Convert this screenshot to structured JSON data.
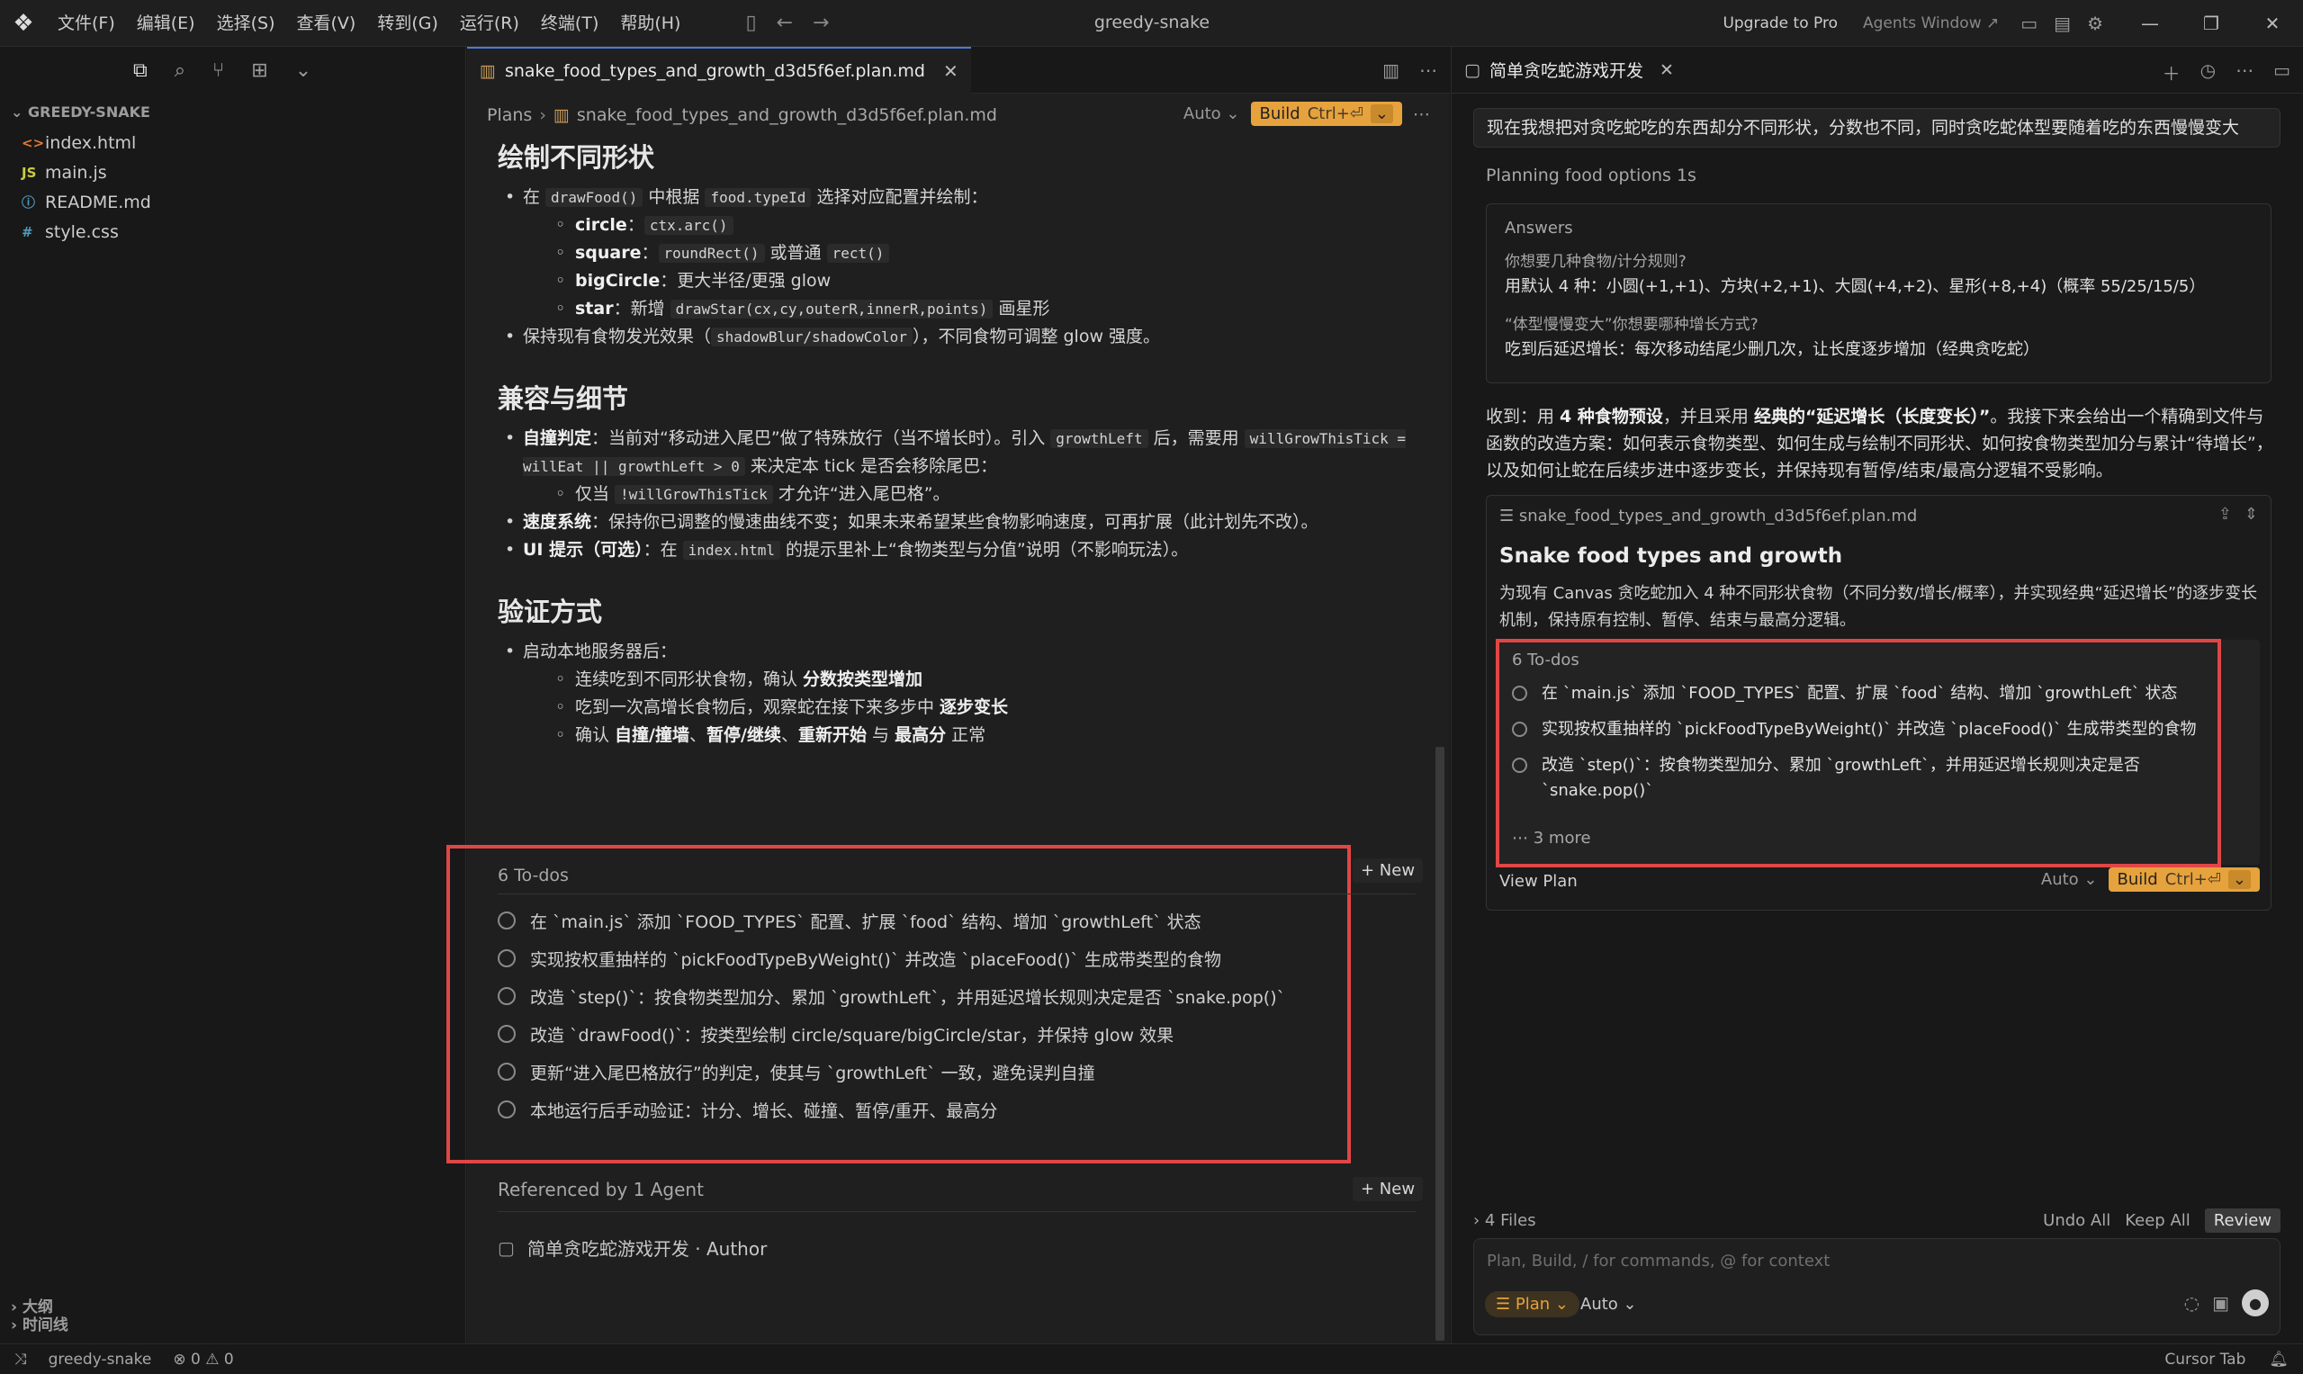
{
  "app": {
    "window_title": "greedy-snake",
    "menu": [
      "文件(F)",
      "编辑(E)",
      "选择(S)",
      "查看(V)",
      "转到(G)",
      "运行(R)",
      "终端(T)",
      "帮助(H)"
    ],
    "upgrade": "Upgrade to Pro",
    "agents_window": "Agents Window ↗"
  },
  "sidebar": {
    "project": "GREEDY-SNAKE",
    "files": [
      {
        "icon": "<>",
        "icon_color": "#e37933",
        "name": "index.html"
      },
      {
        "icon": "JS",
        "icon_color": "#cbcb41",
        "name": "main.js"
      },
      {
        "icon": "ⓘ",
        "icon_color": "#519aba",
        "name": "README.md"
      },
      {
        "icon": "#",
        "icon_color": "#519aba",
        "name": "style.css"
      }
    ],
    "outline": "大纲",
    "timeline": "时间线"
  },
  "editor": {
    "tab_name": "snake_food_types_and_growth_d3d5f6ef.plan.md",
    "breadcrumb_root": "Plans",
    "breadcrumb_file": "snake_food_types_and_growth_d3d5f6ef.plan.md",
    "auto_label": "Auto",
    "build_label": "Build",
    "build_kbd": "Ctrl+⏎",
    "sec1_title": "绘制不同形状",
    "sec1_l1_a": "在 ",
    "sec1_l1_code1": "drawFood()",
    "sec1_l1_b": " 中根据 ",
    "sec1_l1_code2": "food.typeId",
    "sec1_l1_c": " 选择对应配置并绘制：",
    "sec1_circle": "circle",
    "sec1_circle_code": "ctx.arc()",
    "sec1_square": "square",
    "sec1_square_code1": "roundRect()",
    "sec1_square_or": " 或普通 ",
    "sec1_square_code2": "rect()",
    "sec1_big": "bigCircle",
    "sec1_big_text": "：更大半径/更强 glow",
    "sec1_star": "star",
    "sec1_star_a": "：新增 ",
    "sec1_star_code": "drawStar(cx,cy,outerR,innerR,points)",
    "sec1_star_b": " 画星形",
    "sec1_l2_a": "保持现有食物发光效果（",
    "sec1_l2_code": "shadowBlur/shadowColor",
    "sec1_l2_b": "），不同食物可调整 glow 强度。",
    "sec2_title": "兼容与细节",
    "sec2_l1_b": "自撞判定",
    "sec2_l1_a": "：当前对“移动进入尾巴”做了特殊放行（当不增长时）。引入 ",
    "sec2_l1_code1": "growthLeft",
    "sec2_l1_c": " 后，需要用 ",
    "sec2_l1_code2": "willGrowThisTick = willEat || growthLeft > 0",
    "sec2_l1_d": " 来决定本 tick 是否会移除尾巴：",
    "sec2_l1_sub_a": "仅当 ",
    "sec2_l1_sub_code": "!willGrowThisTick",
    "sec2_l1_sub_b": " 才允许“进入尾巴格”。",
    "sec2_l2_b": "速度系统",
    "sec2_l2_a": "：保持你已调整的慢速曲线不变；如果未来希望某些食物影响速度，可再扩展（此计划先不改）。",
    "sec2_l3_b": "UI 提示（可选）",
    "sec2_l3_a": "：在 ",
    "sec2_l3_code": "index.html",
    "sec2_l3_c": " 的提示里补上“食物类型与分值”说明（不影响玩法）。",
    "sec3_title": "验证方式",
    "sec3_l1": "启动本地服务器后：",
    "sec3_s1_a": "连续吃到不同形状食物，确认 ",
    "sec3_s1_b": "分数按类型增加",
    "sec3_s2_a": "吃到一次高增长食物后，观察蛇在接下来多步中 ",
    "sec3_s2_b": "逐步变长",
    "sec3_s3_a": "确认 ",
    "sec3_s3_b1": "自撞/撞墙",
    "sec3_s3_sep1": "、",
    "sec3_s3_b2": "暂停/继续",
    "sec3_s3_sep2": "、",
    "sec3_s3_b3": "重新开始",
    "sec3_s3_and": " 与 ",
    "sec3_s3_b4": "最高分",
    "sec3_s3_end": " 正常",
    "todos_header": "6 To-dos",
    "todos": [
      "在 `main.js` 添加 `FOOD_TYPES` 配置、扩展 `food` 结构、增加 `growthLeft` 状态",
      "实现按权重抽样的 `pickFoodTypeByWeight()` 并改造 `placeFood()` 生成带类型的食物",
      "改造 `step()`：按食物类型加分、累加 `growthLeft`，并用延迟增长规则决定是否 `snake.pop()`",
      "改造 `drawFood()`：按类型绘制 circle/square/bigCircle/star，并保持 glow 效果",
      "更新“进入尾巴格放行”的判定，使其与 `growthLeft` 一致，避免误判自撞",
      "本地运行后手动验证：计分、增长、碰撞、暂停/重开、最高分"
    ],
    "new_label": "+ New",
    "referenced": "Referenced by 1 Agent",
    "ref_agent": "简单贪吃蛇游戏开发 · Author"
  },
  "chat": {
    "tab_title": "简单贪吃蛇游戏开发",
    "user_msg": "现在我想把对贪吃蛇吃的东西却分不同形状，分数也不同，同时贪吃蛇体型要随着吃的东西慢慢变大",
    "planning": "Planning food options 1s",
    "answers_header": "Answers",
    "q1": "你想要几种食物/计分规则?",
    "a1": "用默认 4 种：小圆(+1,+1)、方块(+2,+1)、大圆(+4,+2)、星形(+8,+4)（概率 55/25/15/5）",
    "q2": "“体型慢慢变大”你想要哪种增长方式?",
    "a2": "吃到后延迟增长：每次移动结尾少删几次，让长度逐步增加（经典贪吃蛇）",
    "reply_a": "收到：用 ",
    "reply_b1": "4 种食物预设",
    "reply_c": "，并且采用 ",
    "reply_b2": "经典的“延迟增长（长度变长）”",
    "reply_d": "。我接下来会给出一个精确到文件与函数的改造方案：如何表示食物类型、如何生成与绘制不同形状、如何按食物类型加分与累计“待增长”，以及如何让蛇在后续步进中逐步变长，并保持现有暂停/结束/最高分逻辑不受影响。",
    "card_file": "snake_food_types_and_growth_d3d5f6ef.plan.md",
    "card_title": "Snake food types and growth",
    "card_desc": "为现有 Canvas 贪吃蛇加入 4 种不同形状食物（不同分数/增长/概率），并实现经典“延迟增长”的逐步变长机制，保持原有控制、暂停、结束与最高分逻辑。",
    "card_todos_header": "6 To-dos",
    "card_todos": [
      "在 `main.js` 添加 `FOOD_TYPES` 配置、扩展 `food` 结构、增加 `growthLeft` 状态",
      "实现按权重抽样的 `pickFoodTypeByWeight()` 并改造 `placeFood()` 生成带类型的食物",
      "改造 `step()`：按食物类型加分、累加 `growthLeft`，并用延迟增长规则决定是否 `snake.pop()`"
    ],
    "card_more": "3 more",
    "view_plan": "View Plan",
    "auto_label": "Auto",
    "build_label": "Build",
    "build_kbd": "Ctrl+⏎",
    "files_count": "4 Files",
    "undo_all": "Undo All",
    "keep_all": "Keep All",
    "review": "Review",
    "composer_placeholder": "Plan, Build, / for commands, @ for context",
    "mode": "Plan",
    "model": "Auto"
  },
  "statusbar": {
    "branch": "greedy-snake",
    "problems": "⊗ 0 ⚠ 0",
    "cursor_tab": "Cursor Tab"
  },
  "colors": {
    "accent_red": "#e04646",
    "build_orange": "#e6a23c"
  }
}
